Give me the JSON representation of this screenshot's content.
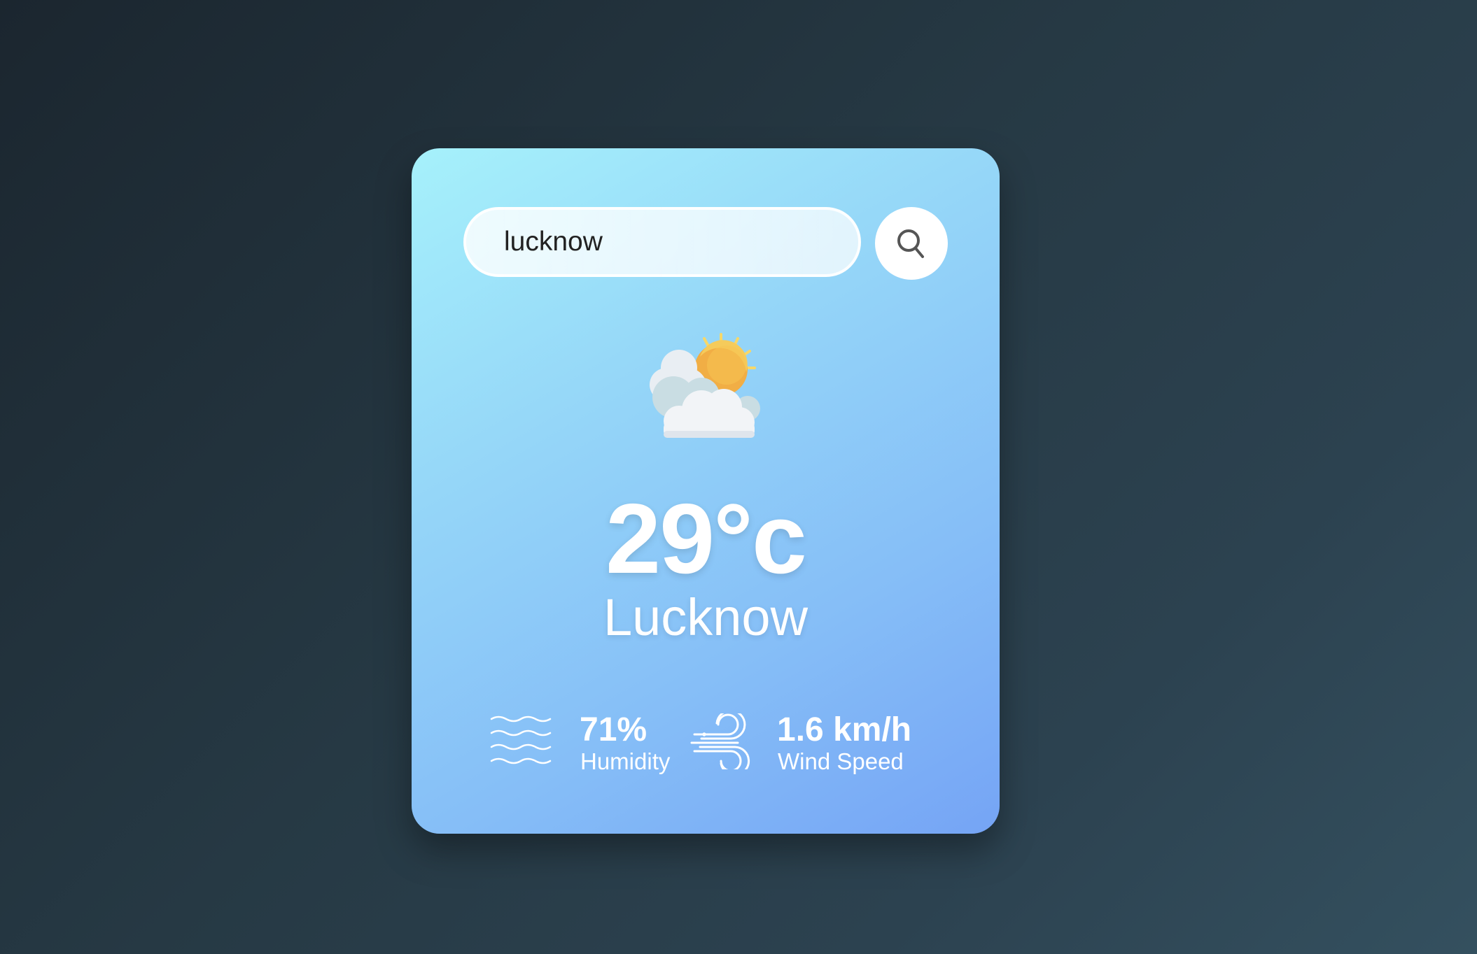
{
  "search": {
    "value": "lucknow",
    "button_icon": "search-icon"
  },
  "weather": {
    "icon": "partly-cloudy-icon",
    "temperature": "29°c",
    "city": "Lucknow"
  },
  "details": {
    "humidity": {
      "icon": "humidity-icon",
      "value": "71%",
      "label": "Humidity"
    },
    "wind": {
      "icon": "wind-icon",
      "value": "1.6 km/h",
      "label": "Wind Speed"
    }
  },
  "colors": {
    "card_gradient_start": "#a6f1fb",
    "card_gradient_end": "#75a4f5",
    "sun": "#f3b847",
    "text": "#ffffff"
  }
}
